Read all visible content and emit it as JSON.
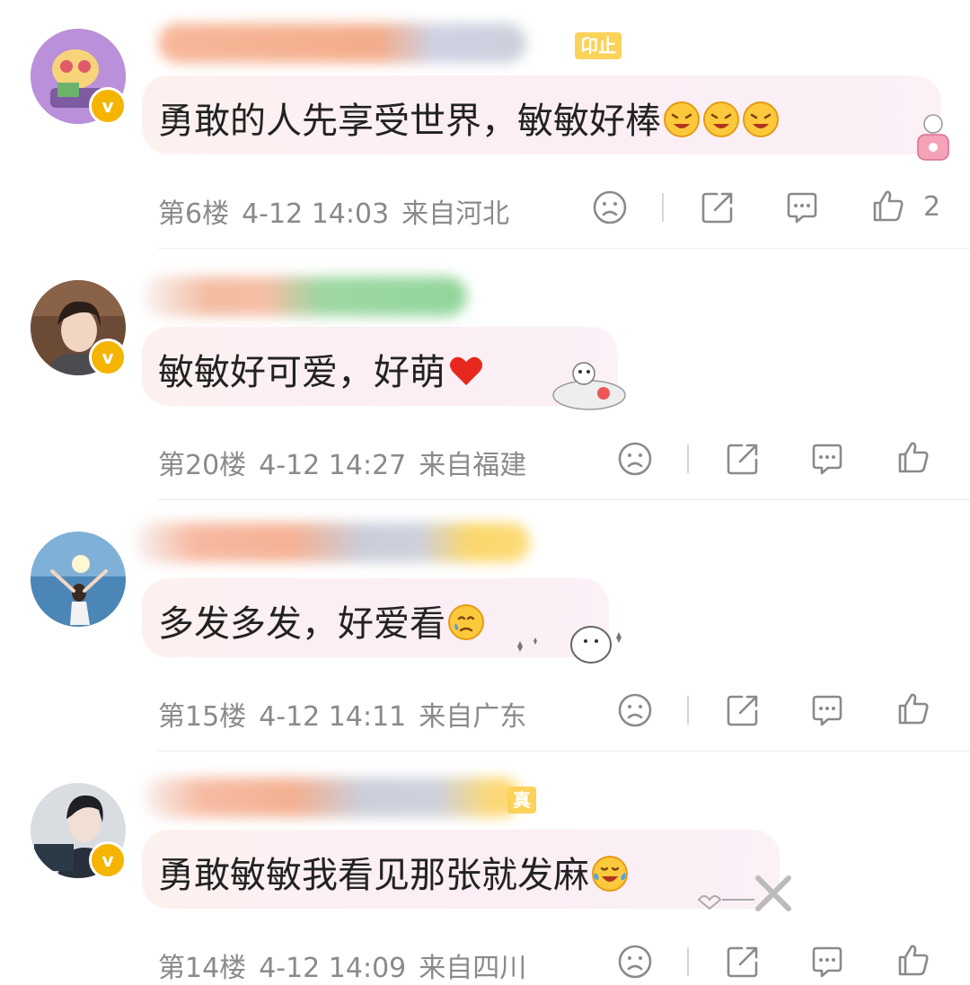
{
  "comments": [
    {
      "text": "勇敢的人先享受世界，敏敏好棒",
      "emoji": "laughing-emoji",
      "floor": "第6楼",
      "time": "4-12 14:03",
      "location": "来自河北",
      "likes": "2",
      "tag": "卬止",
      "verified": true
    },
    {
      "text": "敏敏好可爱，好萌",
      "emoji": "heart-emoji",
      "floor": "第20楼",
      "time": "4-12 14:27",
      "location": "来自福建",
      "likes": "",
      "verified": true
    },
    {
      "text": "多发多发，好爱看",
      "emoji": "crying-emoji",
      "floor": "第15楼",
      "time": "4-12 14:11",
      "location": "来自广东",
      "likes": "",
      "verified": false
    },
    {
      "text": "勇敢敏敏我看见那张就发麻",
      "emoji": "tears-of-joy-emoji",
      "floor": "第14楼",
      "time": "4-12 14:09",
      "location": "来自四川",
      "likes": "",
      "tag": "真",
      "verified": true
    }
  ],
  "colors": {
    "bubble": "#fbeef5",
    "meta": "#8a8a8a",
    "badge": "#f4b400",
    "tag": "#fbd25a"
  },
  "icons": [
    "dislike-icon",
    "share-icon",
    "reply-icon",
    "like-icon"
  ]
}
